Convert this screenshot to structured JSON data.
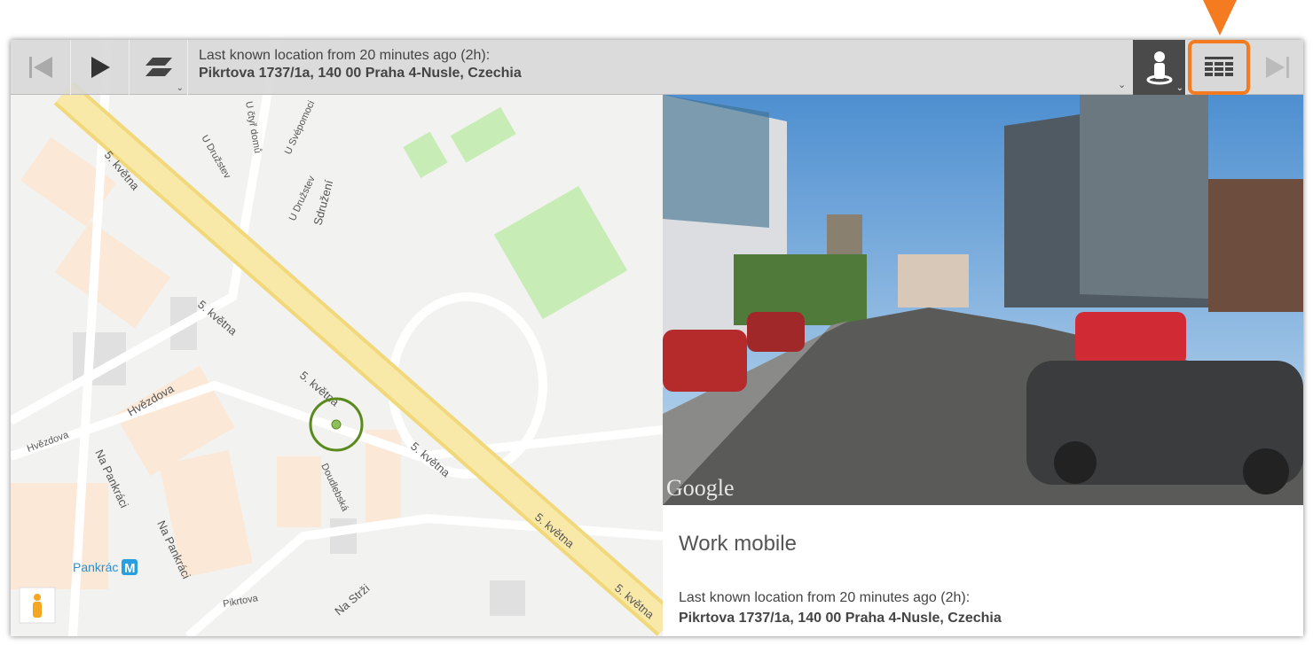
{
  "toolbar": {
    "status_line1": "Last known location from 20 minutes ago (2h):",
    "status_line2": "Pikrtova 1737/1a, 140 00 Praha 4-Nusle, Czechia",
    "icons": [
      "skip-back-icon",
      "play-icon",
      "layers-icon",
      "street-view-person-icon",
      "table-grid-icon",
      "skip-forward-icon"
    ],
    "highlight_color": "#f47b20"
  },
  "map": {
    "labels": [
      "5. května",
      "5. května",
      "5. května",
      "5. května",
      "5. května",
      "5. května",
      "U čtyř domů",
      "U Svépomoci",
      "U Družstev",
      "U Družstev",
      "Sdružení",
      "Hvězdova",
      "Hvězdova",
      "Na Pankráci",
      "Na Pankráci",
      "Pankrác",
      "Doudlebská",
      "Pikrtova",
      "Na Strži"
    ],
    "metro_badge": "M",
    "marker_color": "#5a8a1e"
  },
  "photo": {
    "watermark": "Google"
  },
  "info": {
    "title": "Work mobile",
    "line1": "Last known location from 20 minutes ago (2h):",
    "line2": "Pikrtova 1737/1a, 140 00 Praha 4-Nusle, Czechia"
  }
}
